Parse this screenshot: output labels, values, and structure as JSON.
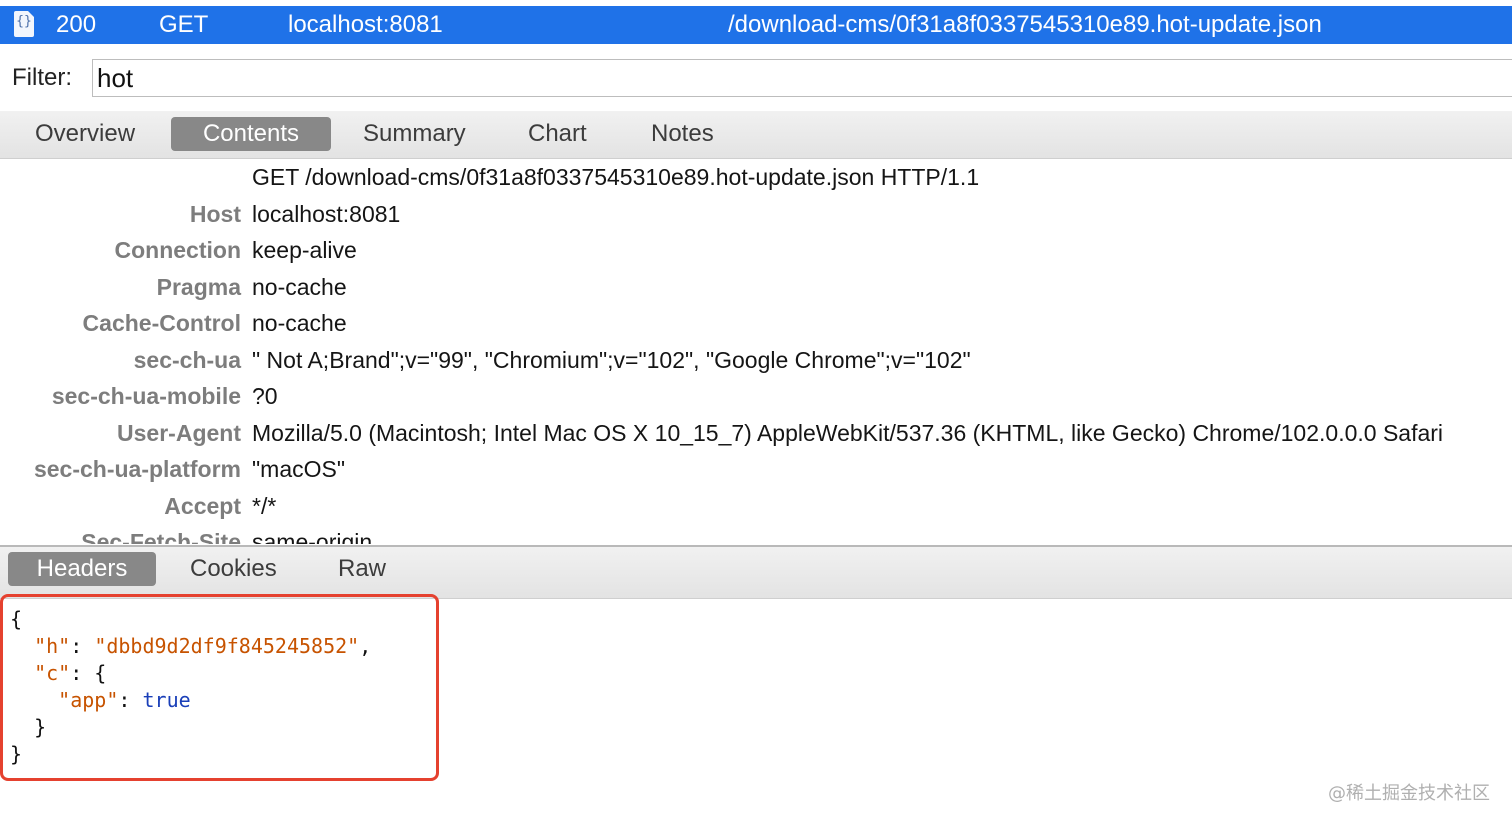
{
  "request_row": {
    "icon": "json-file-icon",
    "icon_glyph": "{}",
    "status": "200",
    "method": "GET",
    "host": "localhost:8081",
    "path": "/download-cms/0f31a8f0337545310e89.hot-update.json"
  },
  "filter": {
    "label": "Filter:",
    "value": "hot"
  },
  "top_tabs": [
    {
      "label": "Overview",
      "active": false
    },
    {
      "label": "Contents",
      "active": true
    },
    {
      "label": "Summary",
      "active": false
    },
    {
      "label": "Chart",
      "active": false
    },
    {
      "label": "Notes",
      "active": false
    }
  ],
  "request_line": "GET /download-cms/0f31a8f0337545310e89.hot-update.json HTTP/1.1",
  "headers": [
    {
      "name": "Host",
      "value": "localhost:8081"
    },
    {
      "name": "Connection",
      "value": "keep-alive"
    },
    {
      "name": "Pragma",
      "value": "no-cache"
    },
    {
      "name": "Cache-Control",
      "value": "no-cache"
    },
    {
      "name": "sec-ch-ua",
      "value": "\" Not A;Brand\";v=\"99\", \"Chromium\";v=\"102\", \"Google Chrome\";v=\"102\""
    },
    {
      "name": "sec-ch-ua-mobile",
      "value": "?0"
    },
    {
      "name": "User-Agent",
      "value": "Mozilla/5.0 (Macintosh; Intel Mac OS X 10_15_7) AppleWebKit/537.36 (KHTML, like Gecko) Chrome/102.0.0.0 Safari"
    },
    {
      "name": "sec-ch-ua-platform",
      "value": "\"macOS\""
    },
    {
      "name": "Accept",
      "value": "*/*"
    },
    {
      "name": "Sec-Fetch-Site",
      "value": "same-origin"
    }
  ],
  "bottom_tabs": [
    {
      "label": "Headers",
      "active": true
    },
    {
      "label": "Cookies",
      "active": false
    },
    {
      "label": "Raw",
      "active": false
    }
  ],
  "json_body": {
    "open_brace": "{",
    "h_key": "\"h\"",
    "h_value": "\"dbbd9d2df9f845245852\"",
    "c_key": "\"c\"",
    "app_key": "\"app\"",
    "app_value": "true",
    "inner_close": "}",
    "close_brace": "}"
  },
  "watermark": "@稀土掘金技术社区",
  "colors": {
    "selection": "#1f72e8",
    "highlight_border": "#e5412f",
    "json_string": "#c75300",
    "json_bool": "#1a3fb8",
    "header_name": "#7d7d7d"
  }
}
